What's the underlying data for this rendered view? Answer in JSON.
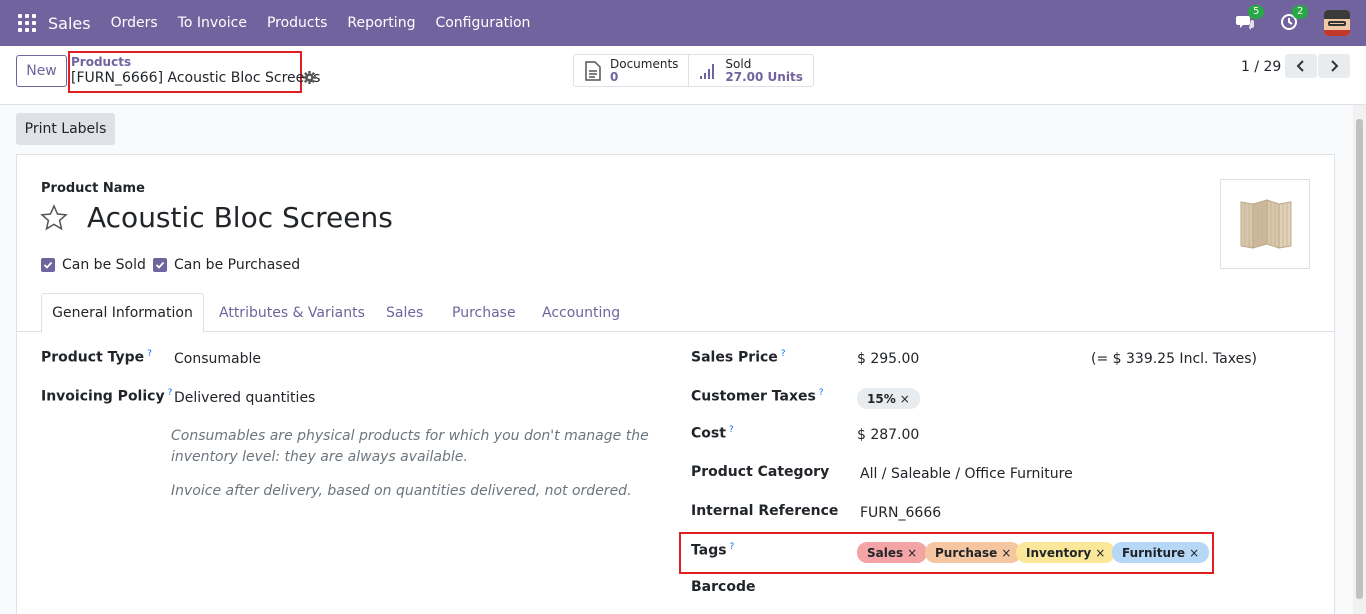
{
  "navbar": {
    "app_name": "Sales",
    "menu": [
      "Orders",
      "To Invoice",
      "Products",
      "Reporting",
      "Configuration"
    ],
    "messages_count": "5",
    "activities_count": "2"
  },
  "control_panel": {
    "new_label": "New",
    "breadcrumb_parent": "Products",
    "breadcrumb_current": "[FURN_6666] Acoustic Bloc Screens",
    "smart_buttons": [
      {
        "label": "Documents",
        "value": "0",
        "icon": "document-icon"
      },
      {
        "label": "Sold",
        "value": "27.00 Units",
        "icon": "bar-chart-icon"
      }
    ],
    "pager": "1 / 29"
  },
  "status_bar": {
    "print_labels": "Print Labels"
  },
  "form": {
    "product_name_label": "Product Name",
    "product_name": "Acoustic Bloc Screens",
    "can_be_sold": "Can be Sold",
    "can_be_purchased": "Can be Purchased",
    "tabs": [
      "General Information",
      "Attributes & Variants",
      "Sales",
      "Purchase",
      "Accounting"
    ],
    "left": {
      "product_type_label": "Product Type",
      "product_type": "Consumable",
      "invoicing_policy_label": "Invoicing Policy",
      "invoicing_policy": "Delivered quantities",
      "help_consumable": "Consumables are physical products for which you don't manage the inventory level: they are always available.",
      "help_invoice": "Invoice after delivery, based on quantities delivered, not ordered."
    },
    "right": {
      "sales_price_label": "Sales Price",
      "sales_price": "$ 295.00",
      "incl_taxes": "(= $ 339.25 Incl. Taxes)",
      "customer_taxes_label": "Customer Taxes",
      "customer_tax": "15%",
      "cost_label": "Cost",
      "cost": "$ 287.00",
      "product_category_label": "Product Category",
      "product_category": "All / Saleable / Office Furniture",
      "internal_reference_label": "Internal Reference",
      "internal_reference": "FURN_6666",
      "tags_label": "Tags",
      "tags": [
        {
          "name": "Sales",
          "color": "#f4a4a4"
        },
        {
          "name": "Purchase",
          "color": "#f5c6a0"
        },
        {
          "name": "Inventory",
          "color": "#fbe79a"
        },
        {
          "name": "Furniture",
          "color": "#b6d7f5"
        }
      ],
      "barcode_label": "Barcode"
    },
    "help_mark": "?",
    "remove_mark": "×"
  },
  "colors": {
    "brand": "#71639e",
    "highlight_border": "#e02020"
  }
}
